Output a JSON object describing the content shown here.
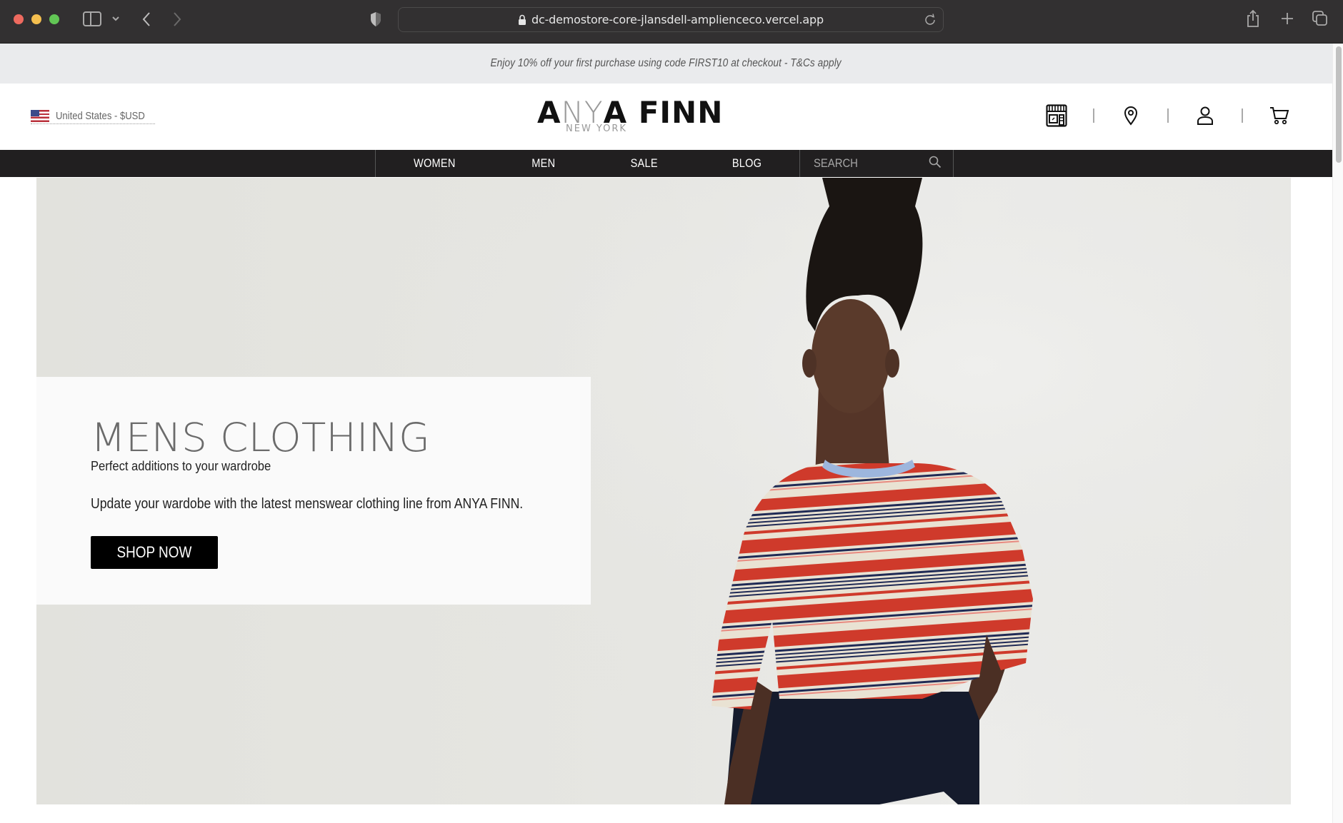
{
  "browser": {
    "url": "dc-demostore-core-jlansdell-amplienceco.vercel.app",
    "icons": [
      "sidebar-toggle-icon",
      "chevron-down-icon",
      "back-icon",
      "forward-icon",
      "privacy-shield-icon",
      "lock-icon",
      "reload-icon",
      "share-icon",
      "new-tab-icon",
      "tab-overview-icon"
    ]
  },
  "promo": {
    "text": "Enjoy 10% off your first purchase using code FIRST10 at checkout - T&Cs apply"
  },
  "header": {
    "locale": {
      "flag": "us-flag-icon",
      "label": "United States - $USD"
    },
    "logo": {
      "part1": "A",
      "part2": "NY",
      "part3": "A FINN",
      "tagline": "NEW YORK"
    },
    "icons": [
      "store-icon",
      "location-pin-icon",
      "account-icon",
      "cart-icon"
    ]
  },
  "nav": {
    "items": [
      {
        "label": "WOMEN"
      },
      {
        "label": "MEN"
      },
      {
        "label": "SALE"
      },
      {
        "label": "BLOG"
      }
    ],
    "search": {
      "placeholder": "SEARCH",
      "value": ""
    }
  },
  "hero": {
    "title": "MENS CLOTHING",
    "subtitle": "Perfect additions to your wardrobe",
    "body": "Update your wardobe with the latest menswear clothing line from ANYA FINN.",
    "cta_label": "SHOP NOW",
    "image_alt": "Model wearing a red, cream and navy striped sweater with navy trousers",
    "colors": {
      "background": "#e3e3df",
      "stripe_red": "#cf3a2b",
      "stripe_cream": "#e9e2d3",
      "stripe_navy": "#1f2a55",
      "trousers": "#151b2c",
      "skin": "#5a3a2b",
      "hair": "#1a1512"
    }
  }
}
